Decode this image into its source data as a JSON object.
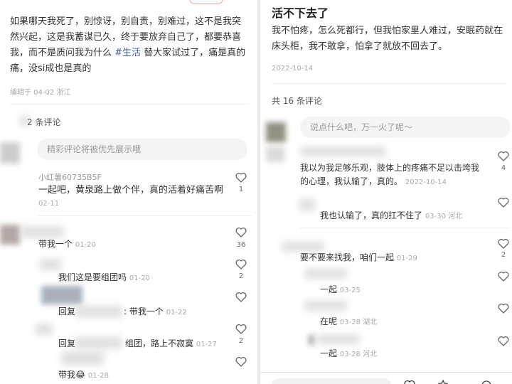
{
  "left": {
    "post_text": "如果哪天我死了，别惊讶，别自责，别难过，这不是我突然兴起，这是我蓄谋已久，终于要放弃自己了，都要恭喜我，而不是质问我为什么 ",
    "post_tag": "#生活",
    "post_text_after": " 替大家试过了，痛是真的痛，没si成也是真的",
    "edited_info": "编辑于 04-02 浙江",
    "comment_count": "2 条评论",
    "search_placeholder": "精彩评论将被优先展示哦",
    "comments": [
      {
        "name": "小红薯60735B5F",
        "text": "一起吧，黄泉路上做个伴，真的活着好痛苦啊",
        "date": "02-11",
        "likes": "1"
      },
      {
        "text": "带我一个",
        "date": "01-20",
        "likes": "36"
      },
      {
        "text": "我们这是要组团吗",
        "date": "01-20",
        "likes": "2"
      },
      {
        "text": "回复",
        "text2": ": 带我一个",
        "date": "01-22",
        "likes": ""
      },
      {
        "text": "回复",
        "text2": "组团，路上不寂寞",
        "date": "01-27",
        "likes": "2"
      },
      {
        "text": "带我",
        "emoji": "😂",
        "date": "01-28",
        "likes": ""
      }
    ]
  },
  "right": {
    "title": "活不下去了",
    "body": "我不怕疼，怎么死都行，但我怕家里人难过，安眠药就在床头柜，我不敢拿，怕拿了就放不回去了。",
    "date": "2022-10-14",
    "comment_count": "共 16 条评论",
    "search_placeholder": "说点什么吧，万一火了呢～",
    "comments": [
      {
        "text": "我以为我足够乐观，肢体上的疼痛不足以击垮我的心理，我认输了，真的。",
        "date": "2022-10-14",
        "likes": "4"
      },
      {
        "text": "我也认输了，真的扛不住了",
        "date": "03-30 河北",
        "likes": ""
      },
      {
        "text": "要不要来找我，咱们一起",
        "date": "01-29",
        "likes": "2"
      },
      {
        "text": "一起",
        "date": "03-25",
        "likes": ""
      },
      {
        "text": "在呢",
        "date": "03-28 湖北",
        "likes": ""
      },
      {
        "text": "一起",
        "date": "03-28 河北",
        "likes": ""
      }
    ]
  }
}
